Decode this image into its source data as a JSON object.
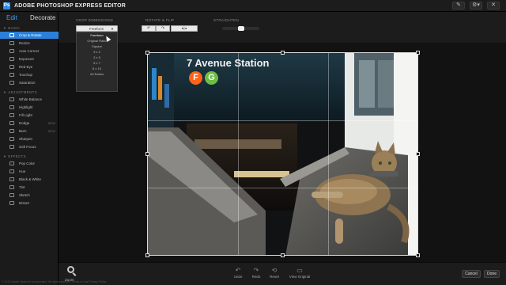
{
  "app": {
    "title": "ADOBE PHOTOSHOP EXPRESS EDITOR",
    "logo": "Ps",
    "titlebar_icons": [
      "brush-icon",
      "gear-icon",
      "close-icon"
    ]
  },
  "mode_tabs": [
    "Edit",
    "Decorate"
  ],
  "sidebar": {
    "sections": [
      {
        "label": "BASIC",
        "items": [
          "Crop & Rotate",
          "Resize",
          "Auto Correct",
          "Exposure",
          "Red Eye",
          "Touchup",
          "Saturation"
        ]
      },
      {
        "label": "ADJUSTMENTS",
        "items": [
          "White Balance",
          "Highlight",
          "Fill Light",
          "Dodge",
          "Burn",
          "Sharpen",
          "Soft Focus"
        ]
      },
      {
        "label": "EFFECTS",
        "items": [
          "Pop Color",
          "Hue",
          "Black & White",
          "Tint",
          "Sketch",
          "Distort"
        ]
      }
    ],
    "active_item": "Crop & Rotate",
    "badges": {
      "Dodge": "NEW",
      "Burn": "NEW"
    }
  },
  "toolbar": {
    "crop_label": "CROP DIMENSIONS",
    "crop_value": "Freeform",
    "crop_options": [
      "Freeform",
      "Original Ratio",
      "Square",
      "3 x 2",
      "3 x 5",
      "5 x 7",
      "8 x 10",
      "All Ratios"
    ],
    "rotate_label": "ROTATE & FLIP",
    "rotate_left": "↶",
    "rotate_right": "↷",
    "flip": "▸|◂",
    "straighten_label": "STRAIGHTEN",
    "straighten_value": 0.45
  },
  "photo": {
    "station_sign": "7 Avenue Station",
    "lines": [
      {
        "letter": "F",
        "color": "#ff6319"
      },
      {
        "letter": "G",
        "color": "#6cbe45"
      }
    ]
  },
  "bottom": {
    "zoom_label": "Zoom",
    "actions": [
      "Undo",
      "Redo",
      "Reset",
      "View Original"
    ],
    "cancel": "Cancel",
    "done": "Done",
    "footer": "© 2010 Adobe Systems Incorporated. All rights reserved.   Terms of Use   Privacy Policy"
  },
  "colors": {
    "accent": "#2b7fd8",
    "edit_tab": "#3d9cf0"
  }
}
